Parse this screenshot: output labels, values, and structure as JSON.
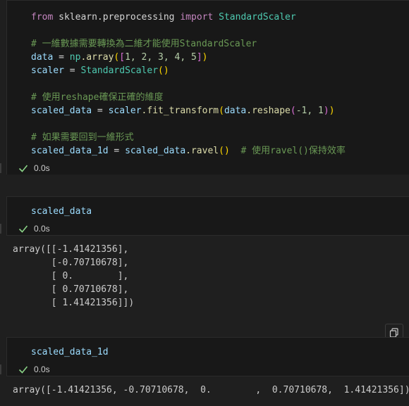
{
  "cell1": {
    "lines": [
      {
        "id": "l1"
      },
      {
        "id": "l2"
      }
    ],
    "code": {
      "import_from": "from",
      "import_module": "sklearn.preprocessing",
      "import_kw": "import",
      "import_name": "StandardScaler",
      "comment1": "# 一維數據需要轉換為二維才能使用StandardScaler",
      "data_var": "data",
      "eq": " = ",
      "np": "np",
      "array_fn": ".array",
      "list_open": "([",
      "nums": "1, 2, 3, 4, 5",
      "list_close": "])",
      "scaler_var": "scaler",
      "scaler_cls": "StandardScaler",
      "call_empty": "()",
      "comment2": "# 使用reshape確保正確的維度",
      "scaled_var": "scaled_data",
      "scaler_ref": "scaler",
      "fit_fn": ".fit_transform",
      "data_ref": "data",
      "reshape_fn": ".reshape",
      "reshape_args": "-1, 1",
      "comment3": "# 如果需要回到一維形式",
      "scaled1d_var": "scaled_data_1d",
      "scaled_ref": "scaled_data",
      "ravel_fn": ".ravel",
      "comment4": "# 使用ravel()保持效率"
    },
    "time": "0.0s"
  },
  "cell2": {
    "code": "scaled_data",
    "time": "0.0s",
    "output": [
      "array([[-1.41421356],",
      "       [-0.70710678],",
      "       [ 0.        ],",
      "       [ 0.70710678],",
      "       [ 1.41421356]])"
    ]
  },
  "cell3": {
    "code": "scaled_data_1d",
    "time": "0.0s",
    "output": "array([-1.41421356, -0.70710678,  0.        ,  0.70710678,  1.41421356])"
  },
  "colors": {
    "success": "#89d185",
    "background": "#1f1f1f",
    "cell": "#181818"
  },
  "icons": {
    "status": "check-icon",
    "copy": "copy-icon"
  }
}
